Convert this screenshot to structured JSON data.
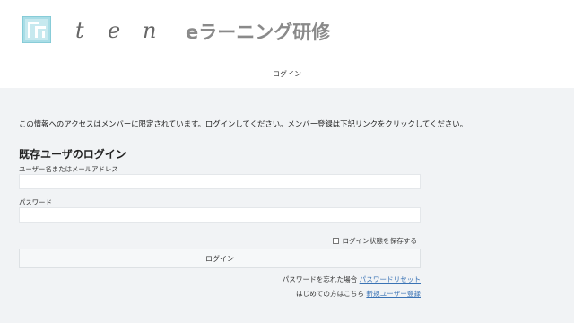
{
  "header": {
    "logo_icon": "ten-logo-mark",
    "logo_letters": [
      "t",
      "e",
      "n"
    ],
    "site_title": "eラーニング研修",
    "nav_login": "ログイン"
  },
  "notice": "この情報へのアクセスはメンバーに限定されています。ログインしてください。メンバー登録は下記リンクをクリックしてください。",
  "login_form": {
    "heading": "既存ユーザのログイン",
    "username_label": "ユーザー名またはメールアドレス",
    "username_value": "",
    "password_label": "パスワード",
    "password_value": "",
    "remember_label": "ログイン状態を保存する",
    "remember_checked": false,
    "submit_label": "ログイン"
  },
  "links": {
    "forgot_prefix": "パスワードを忘れた場合",
    "forgot_link": "パスワードリセット",
    "register_prefix": "はじめての方はこちら",
    "register_link": "新規ユーザー登録"
  },
  "colors": {
    "logo_accent": "#8fd0db",
    "link": "#3a73b5",
    "page_background": "#f1f3f5"
  }
}
